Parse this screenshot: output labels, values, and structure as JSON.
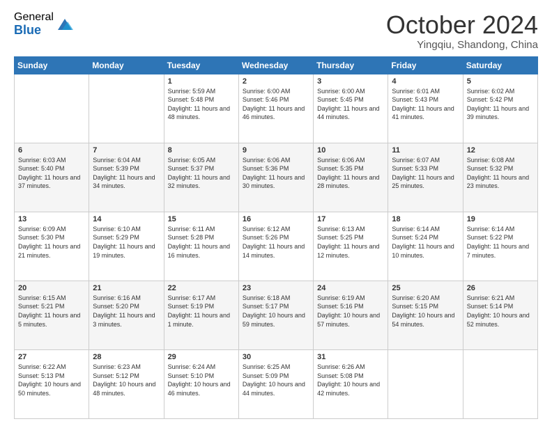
{
  "logo": {
    "general": "General",
    "blue": "Blue"
  },
  "header": {
    "month": "October 2024",
    "location": "Yingqiu, Shandong, China"
  },
  "days_of_week": [
    "Sunday",
    "Monday",
    "Tuesday",
    "Wednesday",
    "Thursday",
    "Friday",
    "Saturday"
  ],
  "weeks": [
    [
      {
        "day": null
      },
      {
        "day": null
      },
      {
        "day": "1",
        "sunrise": "Sunrise: 5:59 AM",
        "sunset": "Sunset: 5:48 PM",
        "daylight": "Daylight: 11 hours and 48 minutes."
      },
      {
        "day": "2",
        "sunrise": "Sunrise: 6:00 AM",
        "sunset": "Sunset: 5:46 PM",
        "daylight": "Daylight: 11 hours and 46 minutes."
      },
      {
        "day": "3",
        "sunrise": "Sunrise: 6:00 AM",
        "sunset": "Sunset: 5:45 PM",
        "daylight": "Daylight: 11 hours and 44 minutes."
      },
      {
        "day": "4",
        "sunrise": "Sunrise: 6:01 AM",
        "sunset": "Sunset: 5:43 PM",
        "daylight": "Daylight: 11 hours and 41 minutes."
      },
      {
        "day": "5",
        "sunrise": "Sunrise: 6:02 AM",
        "sunset": "Sunset: 5:42 PM",
        "daylight": "Daylight: 11 hours and 39 minutes."
      }
    ],
    [
      {
        "day": "6",
        "sunrise": "Sunrise: 6:03 AM",
        "sunset": "Sunset: 5:40 PM",
        "daylight": "Daylight: 11 hours and 37 minutes."
      },
      {
        "day": "7",
        "sunrise": "Sunrise: 6:04 AM",
        "sunset": "Sunset: 5:39 PM",
        "daylight": "Daylight: 11 hours and 34 minutes."
      },
      {
        "day": "8",
        "sunrise": "Sunrise: 6:05 AM",
        "sunset": "Sunset: 5:37 PM",
        "daylight": "Daylight: 11 hours and 32 minutes."
      },
      {
        "day": "9",
        "sunrise": "Sunrise: 6:06 AM",
        "sunset": "Sunset: 5:36 PM",
        "daylight": "Daylight: 11 hours and 30 minutes."
      },
      {
        "day": "10",
        "sunrise": "Sunrise: 6:06 AM",
        "sunset": "Sunset: 5:35 PM",
        "daylight": "Daylight: 11 hours and 28 minutes."
      },
      {
        "day": "11",
        "sunrise": "Sunrise: 6:07 AM",
        "sunset": "Sunset: 5:33 PM",
        "daylight": "Daylight: 11 hours and 25 minutes."
      },
      {
        "day": "12",
        "sunrise": "Sunrise: 6:08 AM",
        "sunset": "Sunset: 5:32 PM",
        "daylight": "Daylight: 11 hours and 23 minutes."
      }
    ],
    [
      {
        "day": "13",
        "sunrise": "Sunrise: 6:09 AM",
        "sunset": "Sunset: 5:30 PM",
        "daylight": "Daylight: 11 hours and 21 minutes."
      },
      {
        "day": "14",
        "sunrise": "Sunrise: 6:10 AM",
        "sunset": "Sunset: 5:29 PM",
        "daylight": "Daylight: 11 hours and 19 minutes."
      },
      {
        "day": "15",
        "sunrise": "Sunrise: 6:11 AM",
        "sunset": "Sunset: 5:28 PM",
        "daylight": "Daylight: 11 hours and 16 minutes."
      },
      {
        "day": "16",
        "sunrise": "Sunrise: 6:12 AM",
        "sunset": "Sunset: 5:26 PM",
        "daylight": "Daylight: 11 hours and 14 minutes."
      },
      {
        "day": "17",
        "sunrise": "Sunrise: 6:13 AM",
        "sunset": "Sunset: 5:25 PM",
        "daylight": "Daylight: 11 hours and 12 minutes."
      },
      {
        "day": "18",
        "sunrise": "Sunrise: 6:14 AM",
        "sunset": "Sunset: 5:24 PM",
        "daylight": "Daylight: 11 hours and 10 minutes."
      },
      {
        "day": "19",
        "sunrise": "Sunrise: 6:14 AM",
        "sunset": "Sunset: 5:22 PM",
        "daylight": "Daylight: 11 hours and 7 minutes."
      }
    ],
    [
      {
        "day": "20",
        "sunrise": "Sunrise: 6:15 AM",
        "sunset": "Sunset: 5:21 PM",
        "daylight": "Daylight: 11 hours and 5 minutes."
      },
      {
        "day": "21",
        "sunrise": "Sunrise: 6:16 AM",
        "sunset": "Sunset: 5:20 PM",
        "daylight": "Daylight: 11 hours and 3 minutes."
      },
      {
        "day": "22",
        "sunrise": "Sunrise: 6:17 AM",
        "sunset": "Sunset: 5:19 PM",
        "daylight": "Daylight: 11 hours and 1 minute."
      },
      {
        "day": "23",
        "sunrise": "Sunrise: 6:18 AM",
        "sunset": "Sunset: 5:17 PM",
        "daylight": "Daylight: 10 hours and 59 minutes."
      },
      {
        "day": "24",
        "sunrise": "Sunrise: 6:19 AM",
        "sunset": "Sunset: 5:16 PM",
        "daylight": "Daylight: 10 hours and 57 minutes."
      },
      {
        "day": "25",
        "sunrise": "Sunrise: 6:20 AM",
        "sunset": "Sunset: 5:15 PM",
        "daylight": "Daylight: 10 hours and 54 minutes."
      },
      {
        "day": "26",
        "sunrise": "Sunrise: 6:21 AM",
        "sunset": "Sunset: 5:14 PM",
        "daylight": "Daylight: 10 hours and 52 minutes."
      }
    ],
    [
      {
        "day": "27",
        "sunrise": "Sunrise: 6:22 AM",
        "sunset": "Sunset: 5:13 PM",
        "daylight": "Daylight: 10 hours and 50 minutes."
      },
      {
        "day": "28",
        "sunrise": "Sunrise: 6:23 AM",
        "sunset": "Sunset: 5:12 PM",
        "daylight": "Daylight: 10 hours and 48 minutes."
      },
      {
        "day": "29",
        "sunrise": "Sunrise: 6:24 AM",
        "sunset": "Sunset: 5:10 PM",
        "daylight": "Daylight: 10 hours and 46 minutes."
      },
      {
        "day": "30",
        "sunrise": "Sunrise: 6:25 AM",
        "sunset": "Sunset: 5:09 PM",
        "daylight": "Daylight: 10 hours and 44 minutes."
      },
      {
        "day": "31",
        "sunrise": "Sunrise: 6:26 AM",
        "sunset": "Sunset: 5:08 PM",
        "daylight": "Daylight: 10 hours and 42 minutes."
      },
      {
        "day": null
      },
      {
        "day": null
      }
    ]
  ]
}
